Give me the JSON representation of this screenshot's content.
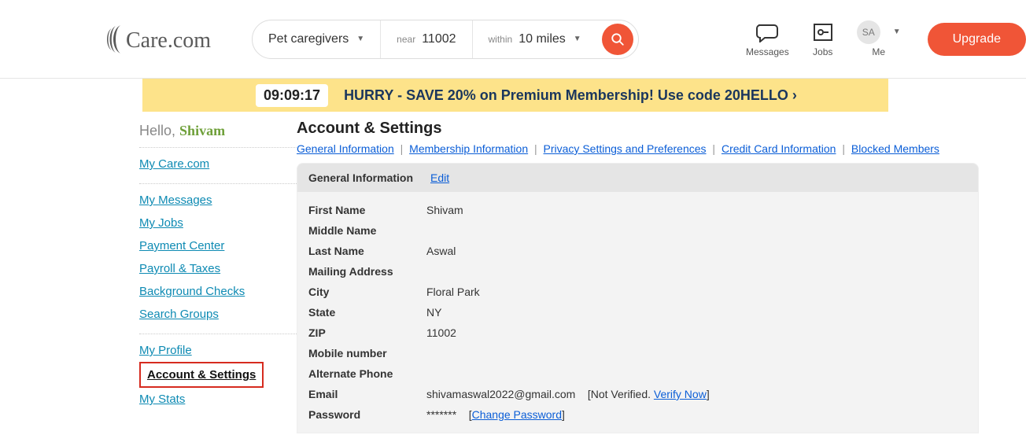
{
  "header": {
    "category": "Pet caregivers",
    "near_label": "near",
    "near_value": "11002",
    "within_label": "within",
    "within_value": "10 miles",
    "messages_label": "Messages",
    "jobs_label": "Jobs",
    "me_label": "Me",
    "avatar_initials": "SA",
    "upgrade_label": "Upgrade"
  },
  "banner": {
    "timer": "09:09:17",
    "text": "HURRY - SAVE 20% on Premium Membership! Use code 20HELLO ›"
  },
  "sidebar": {
    "hello": "Hello,",
    "name": "Shivam",
    "group1": [
      "My Care.com"
    ],
    "group2": [
      "My Messages",
      "My Jobs",
      "Payment Center",
      "Payroll & Taxes",
      "Background Checks",
      "Search Groups"
    ],
    "group3": [
      "My Profile",
      "Account & Settings",
      "My Stats"
    ],
    "active": "Account & Settings"
  },
  "main": {
    "title": "Account & Settings",
    "tabs": [
      "General Information",
      "Membership Information",
      "Privacy Settings and Preferences",
      "Credit Card Information",
      "Blocked Members"
    ],
    "panel_title": "General Information",
    "edit": "Edit",
    "rows": [
      {
        "label": "First Name",
        "value": "Shivam"
      },
      {
        "label": "Middle Name",
        "value": ""
      },
      {
        "label": "Last Name",
        "value": "Aswal"
      },
      {
        "label": "Mailing Address",
        "value": ""
      },
      {
        "label": "City",
        "value": "Floral Park"
      },
      {
        "label": "State",
        "value": "NY"
      },
      {
        "label": "ZIP",
        "value": "11002"
      },
      {
        "label": "Mobile number",
        "value": ""
      },
      {
        "label": "Alternate Phone",
        "value": ""
      }
    ],
    "email_label": "Email",
    "email_value": "shivamaswal2022@gmail.com",
    "email_not_verified": "Not Verified.",
    "email_verify": "Verify Now",
    "password_label": "Password",
    "password_value": "*******",
    "password_change": "Change Password"
  }
}
